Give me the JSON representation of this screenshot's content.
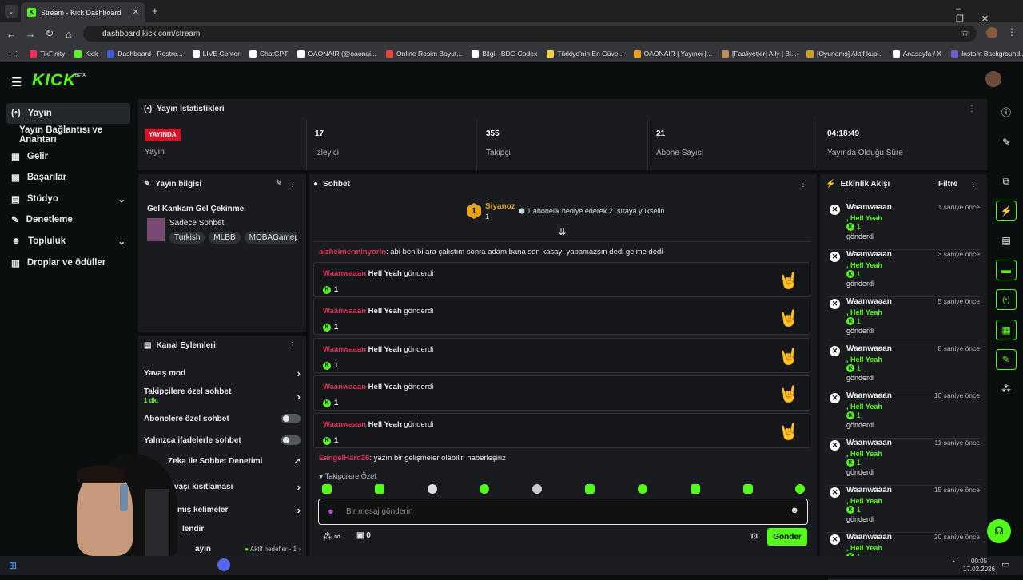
{
  "browser": {
    "tab_title": "Stream - Kick Dashboard",
    "url": "dashboard.kick.com/stream",
    "bookmarks": [
      "TikFinity",
      "Kick",
      "Dashboard - Restre...",
      "LIVE Center",
      "ChatGPT",
      "OAONAIR (@oaonai...",
      "Online Resim Boyut...",
      "Bilgi - BDO Codex",
      "Türkiye'nin En Güve...",
      "OAONAIR | Yayıncı |...",
      "[Faaliyetler] Ally | Bl...",
      "[Oyunanış] Aktif kup...",
      "Anasayfa / X",
      "Instant Background..."
    ]
  },
  "logo": {
    "text": "KICK",
    "beta": "BETA"
  },
  "sidebar": {
    "items": [
      {
        "label": "Yayın",
        "icon": "(•)"
      },
      {
        "label": "Yayın Bağlantısı ve Anahtarı",
        "icon": ""
      },
      {
        "label": "Gelir",
        "icon": "▦"
      },
      {
        "label": "Başarılar",
        "icon": "▩"
      },
      {
        "label": "Stüdyo",
        "icon": "▤"
      },
      {
        "label": "Denetleme",
        "icon": "✎"
      },
      {
        "label": "Topluluk",
        "icon": "☻"
      },
      {
        "label": "Droplar ve ödüller",
        "icon": "▥"
      }
    ]
  },
  "stats": {
    "title": "Yayın İstatistikleri",
    "live_badge": "YAYINDA",
    "live_label": "Yayın",
    "viewers": "17",
    "viewers_label": "İzleyici",
    "followers": "355",
    "followers_label": "Takipçi",
    "subs": "21",
    "subs_label": "Abone Sayısı",
    "uptime": "04:18:49",
    "uptime_label": "Yayında Olduğu Süre"
  },
  "stream_info": {
    "title": "Yayın bilgisi",
    "stream_title": "Gel Kankam Gel Çekinme.",
    "category": "Sadece Sohbet",
    "tags": [
      "Turkish",
      "MLBB",
      "MOBAGamepla"
    ]
  },
  "channel_actions": {
    "title": "Kanal Eylemleri",
    "slow_mode": "Yavaş mod",
    "followers_only": "Takipçilere özel sohbet",
    "followers_only_sub": "1 dk.",
    "subs_only": "Abonelere özel sohbet",
    "emotes_only": "Yalnızca ifadelerle sohbet",
    "ai_mod": "Zeka ile Sohbet Denetimi",
    "limit": "vaşı kısıtlaması",
    "banned_words": "mış kelimeler",
    "pinned": "lendir",
    "goals": "Aktif hedefler - 1",
    "last": "ayın"
  },
  "chat": {
    "title": "Sohbet",
    "top_gifter": "Siyanoz",
    "top_gifter_count": "1",
    "rank_number": "1",
    "promo": "1 abonelik hediye ederek 2. sıraya yükselin",
    "msg1_user": "aizheimerminyorin",
    "msg1_text": ": abi ben bi ara çalıştım sonra adam bana sen kasayı yapamazsın dedi gelme dedi",
    "gift_user": "Waanwaaan",
    "gift_item": "Hell Yeah",
    "gift_verb": "gönderdi",
    "gift_count": "1",
    "msg2_user": "EangelHard26",
    "msg2_text": ": yazın bir gelişmeler olabilir. haberleşiriz",
    "followers_special": "Takipçilere Özel",
    "placeholder": "Bir mesaj gönderin",
    "send": "Gönder",
    "points_value": "0"
  },
  "events": {
    "title": "Etkinlik Akışı",
    "filter": "Filtre",
    "user": "Waanwaaan",
    "item": ", Hell Yeah",
    "count": "1",
    "verb": "gönderdi",
    "times": [
      "1 saniye önce",
      "3 saniye önce",
      "5 saniye önce",
      "8 saniye önce",
      "10 saniye önce",
      "11 saniye önce",
      "15 saniye önce",
      "20 saniye önce"
    ]
  },
  "taskbar": {
    "time": "00:05",
    "date": "17.02.2026"
  }
}
